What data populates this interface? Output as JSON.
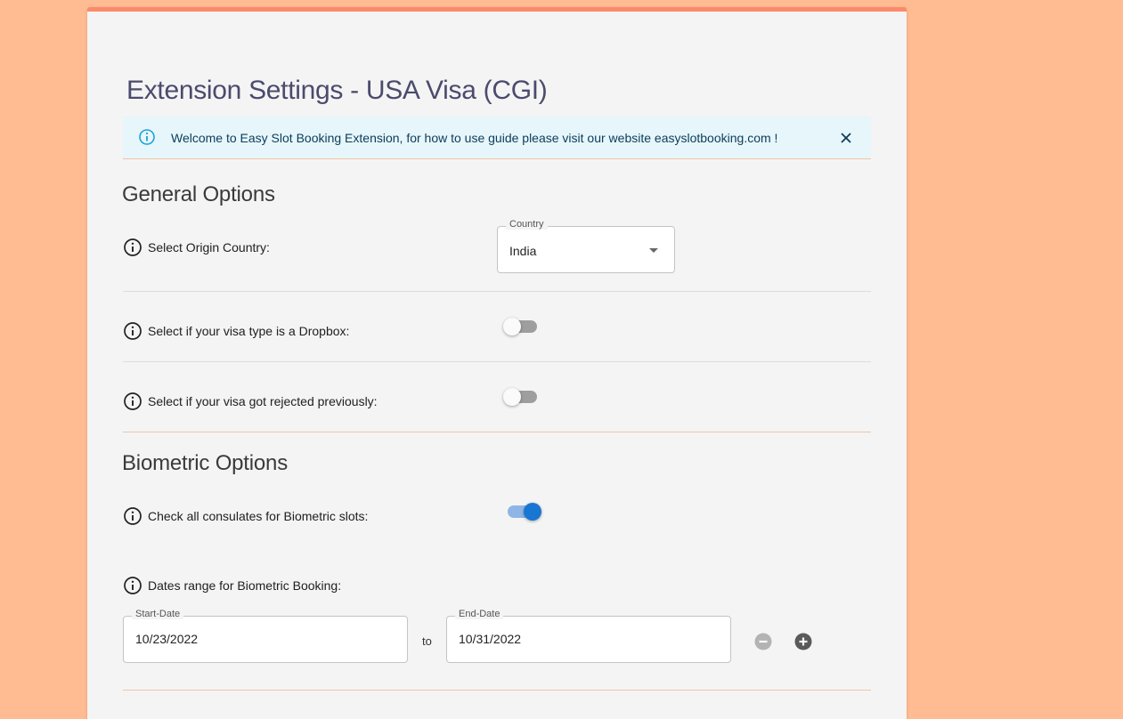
{
  "page": {
    "title": "Extension Settings - USA Visa (CGI)"
  },
  "alert": {
    "icon": "info-icon",
    "message": "Welcome to Easy Slot Booking Extension, for how to use guide please visit our website easyslotbooking.com !",
    "close_icon": "close-icon"
  },
  "general": {
    "title": "General Options",
    "origin_country": {
      "label": "Select Origin Country:",
      "field_label": "Country",
      "value": "India"
    },
    "dropbox": {
      "label": "Select if your visa type is a Dropbox:",
      "checked": false
    },
    "rejected": {
      "label": "Select if your visa got rejected previously:",
      "checked": false
    }
  },
  "biometric": {
    "title": "Biometric Options",
    "all_consulates": {
      "label": "Check all consulates for Biometric slots:",
      "checked": true
    },
    "dates": {
      "label": "Dates range for Biometric Booking:",
      "start_label": "Start-Date",
      "start_value": "10/23/2022",
      "separator": "to",
      "end_label": "End-Date",
      "end_value": "10/31/2022"
    }
  },
  "colors": {
    "background": "#ffbb91",
    "accent": "#fb8a6a",
    "toggle_on": "#1976d2",
    "alert_bg": "#e6f6fb"
  }
}
